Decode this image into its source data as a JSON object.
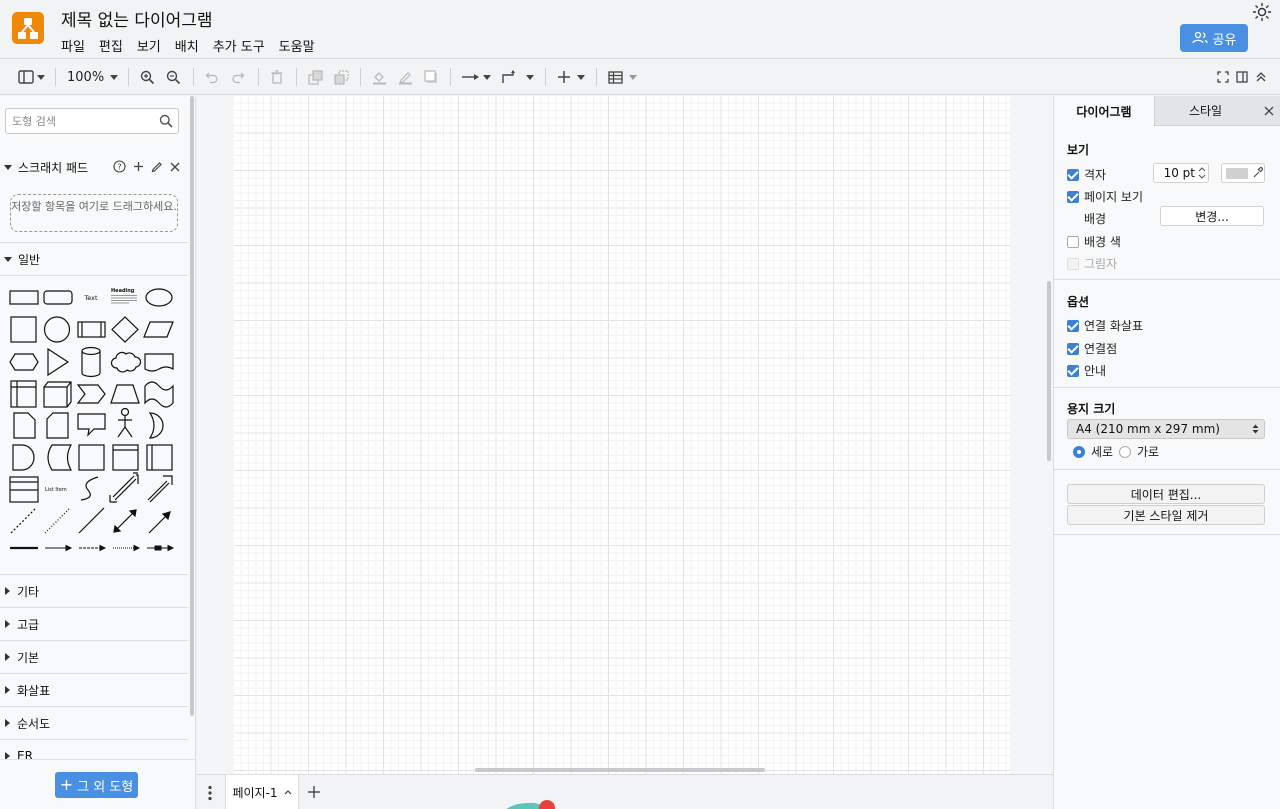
{
  "app": {
    "title": "제목 없는 다이어그램",
    "menu": [
      "파일",
      "편집",
      "보기",
      "배치",
      "추가 도구",
      "도움말"
    ],
    "share_label": "공유"
  },
  "toolbar": {
    "zoom": "100%",
    "accent": "#4a90e2"
  },
  "left": {
    "search_placeholder": "도형 검색",
    "scratchpad_title": "스크래치 패드",
    "dropzone_text": "저장할 항목을 여기로 드래그하세요.",
    "general_title": "일반",
    "collapsed_sections": [
      "기타",
      "고급",
      "기본",
      "화살표",
      "순서도",
      "ER"
    ],
    "shape_text_label": "Text",
    "shape_heading_label": "Heading",
    "shape_list_item_label": "List Item",
    "more_shapes_label": "그 외 도형"
  },
  "pages": {
    "current": "페이지-1"
  },
  "right": {
    "tabs": [
      "다이어그램",
      "스타일"
    ],
    "view_title": "보기",
    "grid_label": "격자",
    "grid_size": "10 pt",
    "page_view_label": "페이지 보기",
    "background_label": "배경",
    "change_label": "변경...",
    "bg_color_label": "배경 색",
    "shadow_label": "그림자",
    "options_title": "옵션",
    "connection_arrows_label": "연결 화살표",
    "connection_points_label": "연결점",
    "guides_label": "안내",
    "paper_title": "용지 크기",
    "paper_size": "A4 (210 mm x 297 mm)",
    "portrait_label": "세로",
    "landscape_label": "가로",
    "edit_data_label": "데이터 편집...",
    "clear_style_label": "기본 스타일 제거",
    "checkbox_color": "#3b82d6"
  }
}
